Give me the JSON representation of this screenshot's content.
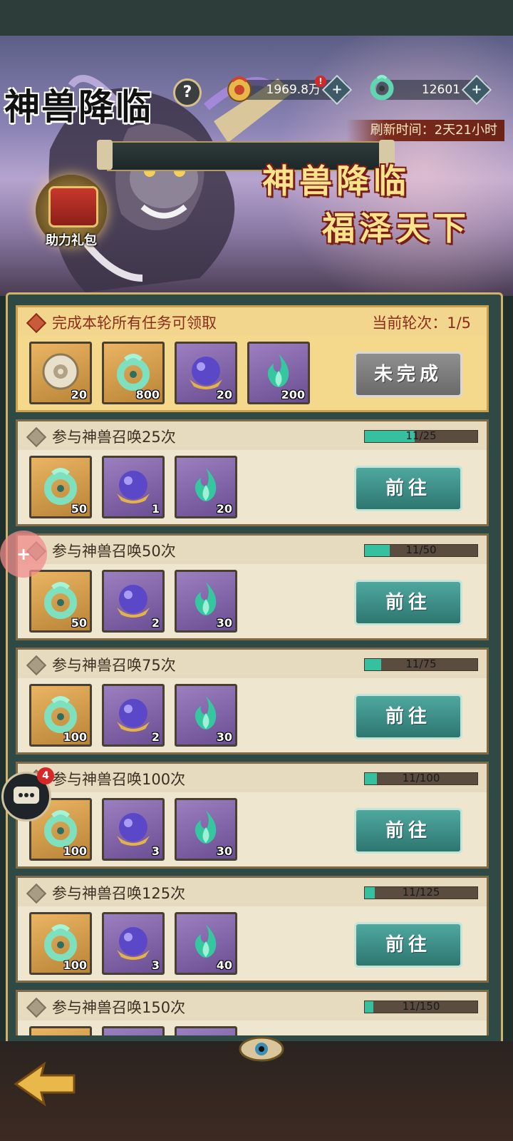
{
  "header": {
    "title": "神兽降临",
    "help_label": "?",
    "currency": [
      {
        "name": "coin",
        "value": "1969.8万",
        "alert": "!",
        "plus": "+"
      },
      {
        "name": "jade",
        "value": "12601",
        "plus": "+"
      }
    ],
    "refresh_label": "刷新时间：2天21小时"
  },
  "banner": {
    "slogan_line1": "神兽降临",
    "slogan_line2": "福泽天下",
    "gift_label": "助力礼包"
  },
  "cards": [
    {
      "task": "完成本轮所有任务可领取",
      "round_label": "当前轮次：1/5",
      "button": "未完成",
      "state": "highlight",
      "rewards": [
        {
          "icon": "disc-icon",
          "qty": "20",
          "bg": "gold"
        },
        {
          "icon": "jade-dragon-icon",
          "qty": "800",
          "bg": "gold"
        },
        {
          "icon": "purple-orb-icon",
          "qty": "20",
          "bg": "purple"
        },
        {
          "icon": "green-flame-icon",
          "qty": "200",
          "bg": "purple"
        }
      ]
    },
    {
      "task": "参与神兽召唤25次",
      "progress_text": "11/25",
      "progress_value": 0.44,
      "button": "前往",
      "rewards": [
        {
          "icon": "jade-dragon-icon",
          "qty": "50",
          "bg": "gold"
        },
        {
          "icon": "purple-orb-icon",
          "qty": "1",
          "bg": "purple"
        },
        {
          "icon": "green-flame-icon",
          "qty": "20",
          "bg": "purple"
        }
      ]
    },
    {
      "task": "参与神兽召唤50次",
      "progress_text": "11/50",
      "progress_value": 0.22,
      "button": "前往",
      "rewards": [
        {
          "icon": "jade-dragon-icon",
          "qty": "50",
          "bg": "gold"
        },
        {
          "icon": "purple-orb-icon",
          "qty": "2",
          "bg": "purple"
        },
        {
          "icon": "green-flame-icon",
          "qty": "30",
          "bg": "purple"
        }
      ]
    },
    {
      "task": "参与神兽召唤75次",
      "progress_text": "11/75",
      "progress_value": 0.147,
      "button": "前往",
      "rewards": [
        {
          "icon": "jade-dragon-icon",
          "qty": "100",
          "bg": "gold"
        },
        {
          "icon": "purple-orb-icon",
          "qty": "2",
          "bg": "purple"
        },
        {
          "icon": "green-flame-icon",
          "qty": "30",
          "bg": "purple"
        }
      ]
    },
    {
      "task": "参与神兽召唤100次",
      "progress_text": "11/100",
      "progress_value": 0.11,
      "button": "前往",
      "rewards": [
        {
          "icon": "jade-dragon-icon",
          "qty": "100",
          "bg": "gold"
        },
        {
          "icon": "purple-orb-icon",
          "qty": "3",
          "bg": "purple"
        },
        {
          "icon": "green-flame-icon",
          "qty": "30",
          "bg": "purple"
        }
      ]
    },
    {
      "task": "参与神兽召唤125次",
      "progress_text": "11/125",
      "progress_value": 0.088,
      "button": "前往",
      "rewards": [
        {
          "icon": "jade-dragon-icon",
          "qty": "100",
          "bg": "gold"
        },
        {
          "icon": "purple-orb-icon",
          "qty": "3",
          "bg": "purple"
        },
        {
          "icon": "green-flame-icon",
          "qty": "40",
          "bg": "purple"
        }
      ]
    },
    {
      "task": "参与神兽召唤150次",
      "progress_text": "11/150",
      "progress_value": 0.073,
      "button": "前往",
      "rewards": [
        {
          "icon": "jade-dragon-icon",
          "qty": "",
          "bg": "gold"
        },
        {
          "icon": "purple-orb-icon",
          "qty": "",
          "bg": "purple"
        },
        {
          "icon": "green-flame-icon",
          "qty": "",
          "bg": "purple"
        }
      ]
    }
  ],
  "floating": {
    "chat_badge": "4",
    "gamepad_label": "+"
  }
}
